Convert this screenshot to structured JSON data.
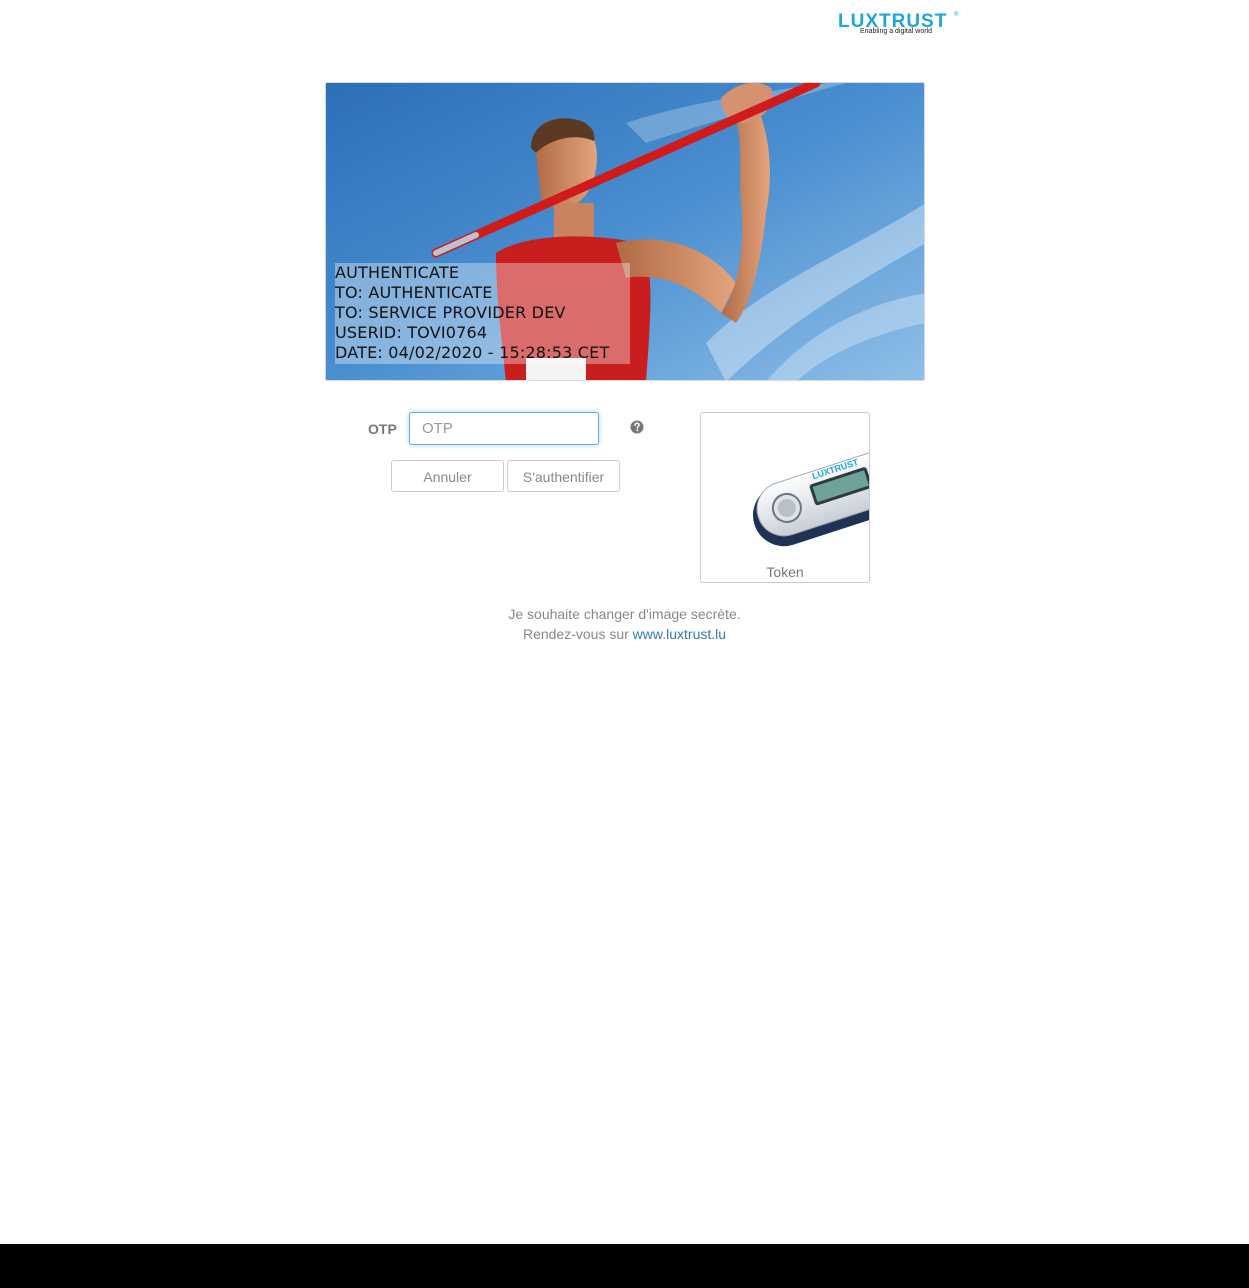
{
  "brand": {
    "name": "LUXTRUST",
    "registered_mark": "®",
    "tagline": "Enabling a digital world",
    "color": "#1ba6de"
  },
  "secret_image": {
    "lines": [
      "AUTHENTICATE",
      "TO: AUTHENTICATE",
      "TO: SERVICE PROVIDER DEV",
      "USERID: TOVI0764",
      "DATE: 04/02/2020 - 15:28:53 CET"
    ]
  },
  "form": {
    "otp_label": "OTP",
    "otp_placeholder": "OTP",
    "otp_value": "",
    "help_icon": "question-circle-icon",
    "cancel_label": "Annuler",
    "submit_label": "S'authentifier"
  },
  "device": {
    "label": "Token",
    "brand_on_device": "LUXTRUST"
  },
  "footer": {
    "line1": "Je souhaite changer d'image secrète.",
    "line2_prefix": "Rendez-vous sur",
    "link_text": "www.luxtrust.lu"
  }
}
